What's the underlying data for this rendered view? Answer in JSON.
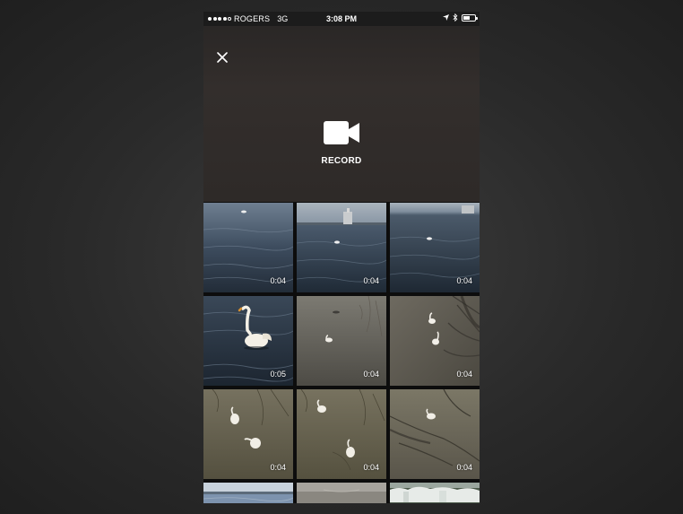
{
  "status_bar": {
    "carrier": "ROGERS",
    "network": "3G",
    "time": "3:08 PM",
    "signal_bars_filled": 4,
    "signal_bars_total": 5
  },
  "record_panel": {
    "close_icon": "close-icon",
    "record_icon": "video-camera-icon",
    "record_label": "RECORD"
  },
  "videos": [
    {
      "duration": "0:04",
      "scene": "lake-swan-distant"
    },
    {
      "duration": "0:04",
      "scene": "lake-lighthouse-swan"
    },
    {
      "duration": "0:04",
      "scene": "lake-swan-distant-2"
    },
    {
      "duration": "0:05",
      "scene": "swan-closeup"
    },
    {
      "duration": "0:04",
      "scene": "shallow-water-swans"
    },
    {
      "duration": "0:04",
      "scene": "shore-two-swans"
    },
    {
      "duration": "0:04",
      "scene": "two-swans-muddy"
    },
    {
      "duration": "0:04",
      "scene": "two-swans-muddy-2"
    },
    {
      "duration": "0:04",
      "scene": "swan-shore-branches"
    },
    {
      "duration": "",
      "scene": "partial-lake"
    },
    {
      "duration": "",
      "scene": "partial-lake-2"
    },
    {
      "duration": "",
      "scene": "partial-ice-shore"
    }
  ],
  "colors": {
    "background": "#2c2c2c",
    "panel": "#2f2b29",
    "text": "#ffffff"
  }
}
